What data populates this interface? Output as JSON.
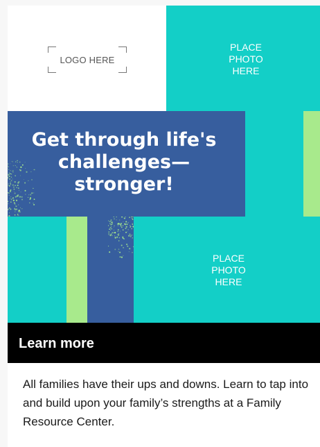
{
  "logo": {
    "placeholder": "LOGO HERE"
  },
  "photos": [
    {
      "placeholder": "PLACE\nPHOTO\nHERE"
    },
    {
      "placeholder": "PLACE\nPHOTO\nHERE"
    }
  ],
  "headline": "Get through life's\nchallenges—\nstronger!",
  "cta": {
    "label": "Learn more"
  },
  "body": "All families have their ups and downs. Learn to tap into and build upon your family’s strengths at a Family Resource Center.",
  "colors": {
    "teal": "#13cfc7",
    "blue": "#375e9e",
    "green": "#a8ea8c",
    "black": "#000000"
  }
}
